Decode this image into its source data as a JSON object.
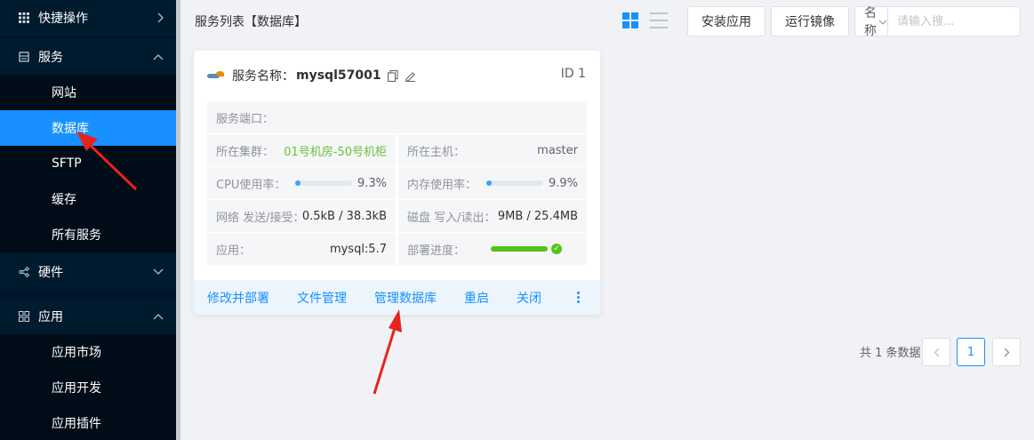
{
  "sidebar": {
    "groups": [
      {
        "label": "快捷操作",
        "icon": "grid-icon",
        "arrow": "›"
      },
      {
        "label": "服务",
        "icon": "server-icon",
        "arrow": "⌃"
      },
      {
        "label": "硬件",
        "icon": "share-icon",
        "arrow": "⌄"
      },
      {
        "label": "应用",
        "icon": "apps-icon",
        "arrow": "⌃"
      }
    ],
    "service_items": [
      "网站",
      "数据库",
      "SFTP",
      "缓存",
      "所有服务"
    ],
    "app_items": [
      "应用市场",
      "应用开发",
      "应用插件"
    ],
    "active_item": "数据库"
  },
  "header": {
    "title": "服务列表【数据库】",
    "install_label": "安装应用",
    "run_image_label": "运行镜像",
    "search_field": "名称",
    "search_placeholder": "请输入搜..."
  },
  "card": {
    "title_label": "服务名称：",
    "name": "mysql57001",
    "id_text": "ID 1",
    "rows": {
      "port_label": "服务端口：",
      "cluster_label": "所在集群：",
      "cluster_value": "01号机房-50号机柜",
      "host_label": "所在主机：",
      "host_value": "master",
      "cpu_label": "CPU使用率：",
      "cpu_value": "9.3%",
      "mem_label": "内存使用率：",
      "mem_value": "9.9%",
      "net_label": "网络 发送/接受：",
      "net_value": "0.5kB / 38.3kB",
      "disk_label": "磁盘 写入/读出：",
      "disk_value": "9MB / 25.4MB",
      "app_label": "应用：",
      "app_value": "mysql:5.7",
      "deploy_label": "部署进度："
    },
    "cpu_fraction": 0.093,
    "mem_fraction": 0.099,
    "deploy_fraction": 1.0,
    "actions": [
      "修改并部署",
      "文件管理",
      "管理数据库",
      "重启",
      "关闭"
    ]
  },
  "pagination": {
    "total_text": "共 1 条数据",
    "current_page": "1"
  },
  "colors": {
    "accent": "#1890ff",
    "sidebar_bg": "#001529",
    "success": "#52c41a",
    "annotation": "#e8231d"
  }
}
